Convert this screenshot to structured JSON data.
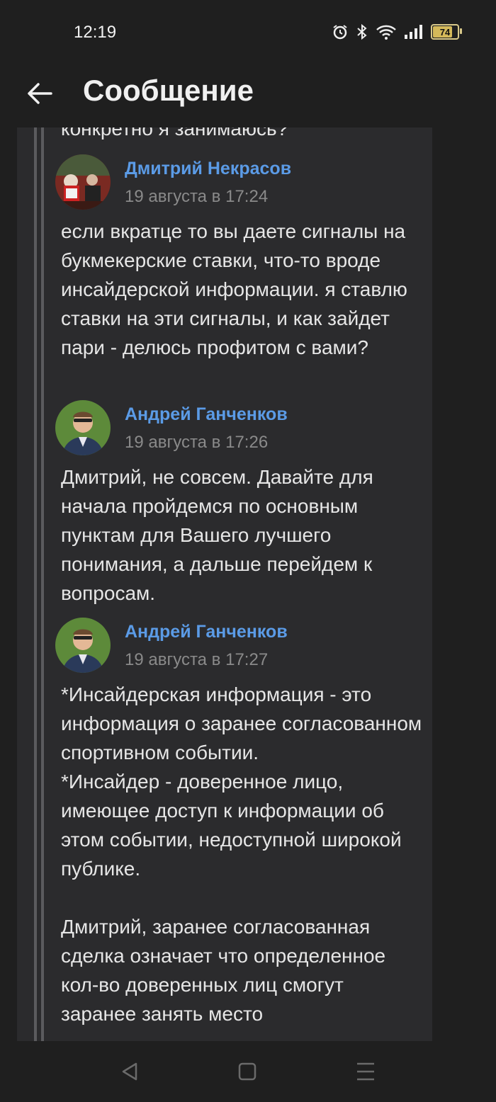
{
  "status": {
    "time": "12:19",
    "battery": "74"
  },
  "header": {
    "title": "Сообщение"
  },
  "thread": {
    "partial_text": "конкретно я занимаюсь?",
    "messages": [
      {
        "author": "Дмитрий Некрасов",
        "date": "19 августа в 17:24",
        "text": "если вкратце то вы даете сигналы на букмекерские ставки, что-то вроде инсайдерской информации. я ставлю ставки на эти сигналы, и как зайдет пари - делюсь профитом с вами?"
      },
      {
        "author": "Андрей Ганченков",
        "date": "19 августа в 17:26",
        "text": "Дмитрий, не совсем. Давайте для начала пройдемся по основным пунктам для Вашего лучшего понимания, а дальше перейдем к вопросам."
      },
      {
        "author": "Андрей Ганченков",
        "date": "19 августа в 17:27",
        "text": "*Инсайдерская информация - это информация о заранее согласованном спортивном событии.\n*Инсайдер - доверенное лицо, имеющее доступ к информации об этом событии, недоступной широкой публике.\n\nДмитрий, заранее согласованная сделка означает что определенное кол-во доверенных лиц смогут заранее занять место"
      }
    ]
  },
  "icons": {
    "back": "arrow-left-icon",
    "alarm": "alarm-icon",
    "bluetooth": "bluetooth-icon",
    "wifi": "wifi-icon",
    "signal": "signal-icon",
    "nav_back": "triangle-back-icon",
    "nav_home": "square-home-icon",
    "nav_menu": "menu-lines-icon"
  },
  "colors": {
    "link": "#5b9be6",
    "background": "#1f1f1f",
    "card": "#2b2b2d"
  }
}
